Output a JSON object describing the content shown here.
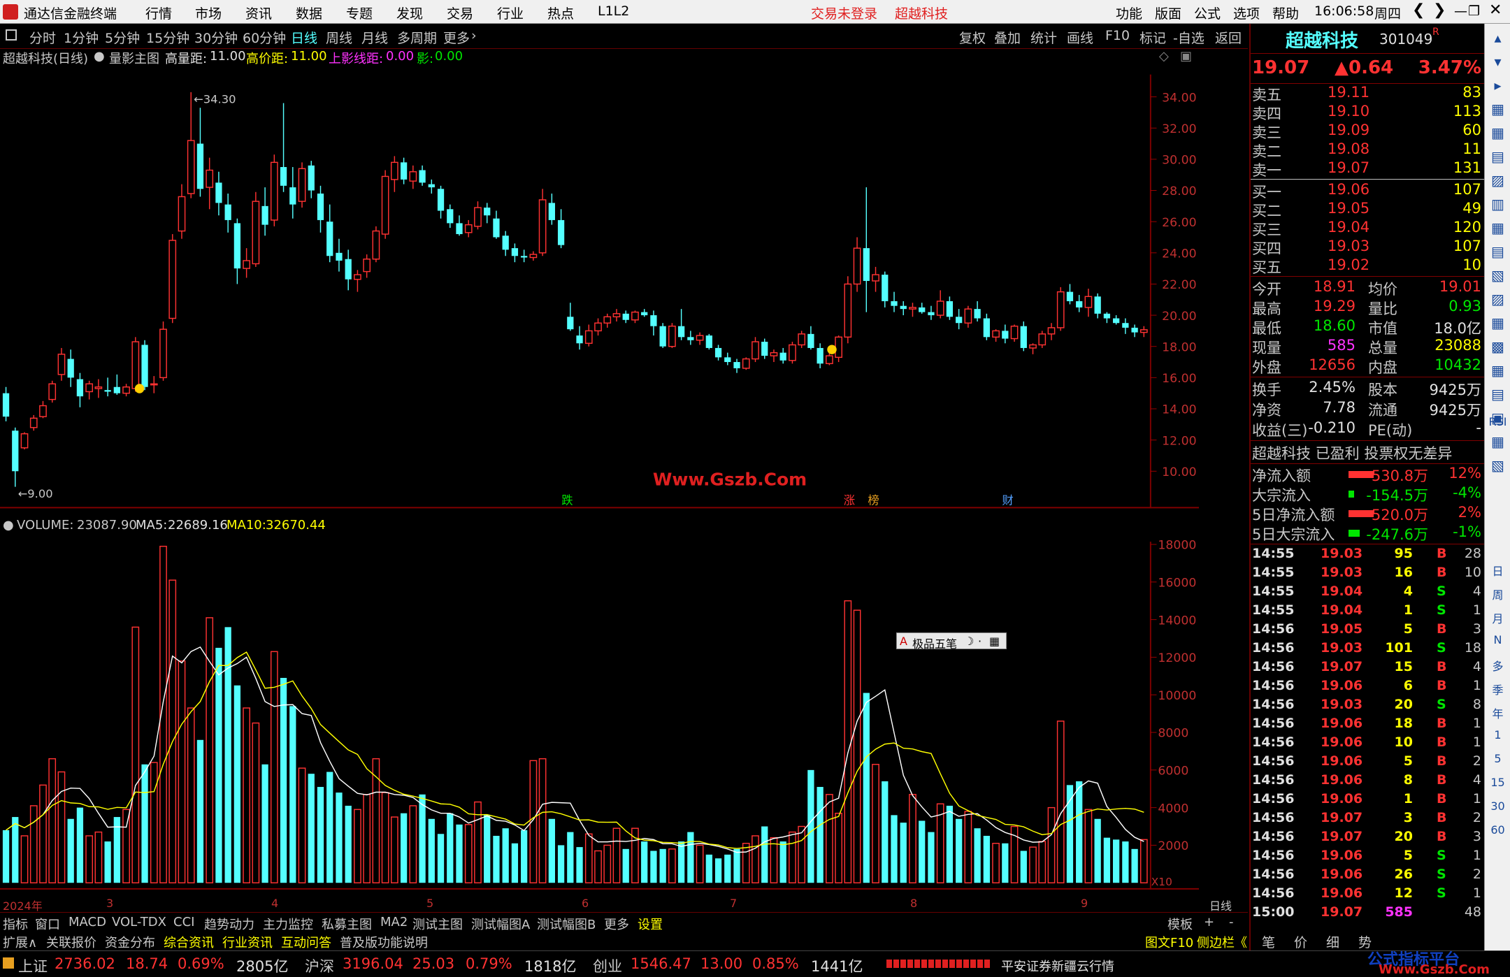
{
  "titlebar": {
    "app": "通达信金融终端",
    "menu": [
      "行情",
      "市场",
      "资讯",
      "数据",
      "专题",
      "发现",
      "交易",
      "行业",
      "热点",
      "L1L2"
    ],
    "login": "交易未登录",
    "stock": "超越科技",
    "right": [
      "功能",
      "版面",
      "公式",
      "选项",
      "帮助"
    ],
    "time": "16:06:58",
    "weekday": "周四"
  },
  "toolbar": {
    "periods": [
      "分时",
      "1分钟",
      "5分钟",
      "15分钟",
      "30分钟",
      "60分钟",
      "日线",
      "周线",
      "月线",
      "多周期",
      "更多"
    ],
    "active": "日线",
    "tools": [
      "复权",
      "叠加",
      "统计",
      "画线",
      "F10",
      "标记",
      "-自选",
      "返回"
    ]
  },
  "chartinfo": {
    "name": "超越科技(日线)",
    "indicator": "量影主图",
    "gao_label": "高量距:",
    "gao_val": "11.00",
    "gaojia_label": "高价距:",
    "gaojia_val": "11.00",
    "shang_label": "上影线距:",
    "shang_val": "0.00",
    "ying_label": "影:",
    "ying_val": "0.00"
  },
  "mainaxis": [
    "34.00",
    "32.00",
    "30.00",
    "28.00",
    "26.00",
    "24.00",
    "22.00",
    "20.00",
    "18.00",
    "16.00",
    "14.00",
    "12.00",
    "10.00"
  ],
  "annotations": {
    "high": "34.30",
    "low": "9.00",
    "watermark": "Www.Gszb.Com",
    "m1": "跌",
    "m2": "涨",
    "m3": "榜",
    "m4": "财"
  },
  "volinfo": {
    "label": "VOLUME:",
    "volume": "23087.90",
    "ma5_label": "MA5:",
    "ma5": "22689.16",
    "ma10_label": "MA10:",
    "ma10": "32670.44"
  },
  "volaxis": [
    "18000",
    "16000",
    "14000",
    "12000",
    "10000",
    "8000",
    "6000",
    "4000",
    "2000"
  ],
  "volunit": "X10",
  "popup": "极品五笔",
  "dates": [
    "2024年",
    "3",
    "4",
    "5",
    "6",
    "7",
    "8",
    "9"
  ],
  "datelabel": "日线",
  "tabs1": [
    "指标",
    "窗口",
    "MACD",
    "VOL-TDX",
    "CCI",
    "趋势动力",
    "主力监控",
    "私募主图",
    "MA2",
    "测试主图",
    "测试幅图A",
    "测试幅图B",
    "更多",
    "设置"
  ],
  "tabs1_right": [
    "模板",
    "+",
    "-"
  ],
  "tabs2": [
    "扩展∧",
    "关联报价",
    "资金分布",
    "综合资讯",
    "行业资讯",
    "互动问答",
    "普及版功能说明"
  ],
  "tabs2_right": [
    "图文F10",
    "侧边栏《"
  ],
  "panel": {
    "name": "超越科技",
    "code": "301049",
    "mark": "R",
    "price": "19.07",
    "change": "▲0.64",
    "pct": "3.47%",
    "asks": [
      [
        "卖五",
        "19.11",
        "83"
      ],
      [
        "卖四",
        "19.10",
        "113"
      ],
      [
        "卖三",
        "19.09",
        "60"
      ],
      [
        "卖二",
        "19.08",
        "11"
      ],
      [
        "卖一",
        "19.07",
        "131"
      ]
    ],
    "bids": [
      [
        "买一",
        "19.06",
        "107"
      ],
      [
        "买二",
        "19.05",
        "49"
      ],
      [
        "买三",
        "19.04",
        "120"
      ],
      [
        "买四",
        "19.03",
        "107"
      ],
      [
        "买五",
        "19.02",
        "10"
      ]
    ],
    "stats": [
      [
        "今开",
        "18.91",
        "均价",
        "19.01"
      ],
      [
        "最高",
        "19.29",
        "量比",
        "0.93"
      ],
      [
        "最低",
        "18.60",
        "市值",
        "18.0亿"
      ],
      [
        "现量",
        "585",
        "总量",
        "23088"
      ],
      [
        "外盘",
        "12656",
        "内盘",
        "10432"
      ]
    ],
    "stats2": [
      [
        "换手",
        "2.45%",
        "股本",
        "9425万"
      ],
      [
        "净资",
        "7.78",
        "流通",
        "9425万"
      ],
      [
        "收益(三)",
        "-0.210",
        "PE(动)",
        "-"
      ]
    ],
    "status": "超越科技 已盈利 投票权无差异",
    "flows": [
      [
        "净流入额",
        "530.8万",
        "12%"
      ],
      [
        "大宗流入",
        "-154.5万",
        "-4%"
      ],
      [
        "5日净流入额",
        "520.0万",
        "2%"
      ],
      [
        "5日大宗流入",
        "-247.6万",
        "-1%"
      ]
    ],
    "ticks": [
      [
        "14:55",
        "19.03",
        "95",
        "B",
        "28"
      ],
      [
        "14:55",
        "19.03",
        "16",
        "B",
        "10"
      ],
      [
        "14:55",
        "19.04",
        "4",
        "S",
        "4"
      ],
      [
        "14:55",
        "19.04",
        "1",
        "S",
        "1"
      ],
      [
        "14:56",
        "19.05",
        "5",
        "B",
        "3"
      ],
      [
        "14:56",
        "19.03",
        "101",
        "S",
        "18"
      ],
      [
        "14:56",
        "19.07",
        "15",
        "B",
        "4"
      ],
      [
        "14:56",
        "19.06",
        "6",
        "B",
        "1"
      ],
      [
        "14:56",
        "19.03",
        "20",
        "S",
        "8"
      ],
      [
        "14:56",
        "19.06",
        "18",
        "B",
        "1"
      ],
      [
        "14:56",
        "19.06",
        "10",
        "B",
        "1"
      ],
      [
        "14:56",
        "19.06",
        "5",
        "B",
        "2"
      ],
      [
        "14:56",
        "19.06",
        "8",
        "B",
        "4"
      ],
      [
        "14:56",
        "19.06",
        "1",
        "B",
        "1"
      ],
      [
        "14:56",
        "19.07",
        "3",
        "B",
        "2"
      ],
      [
        "14:56",
        "19.07",
        "20",
        "B",
        "3"
      ],
      [
        "14:56",
        "19.06",
        "5",
        "S",
        "1"
      ],
      [
        "14:56",
        "19.06",
        "26",
        "S",
        "2"
      ],
      [
        "14:56",
        "19.06",
        "12",
        "S",
        "1"
      ],
      [
        "15:00",
        "19.07",
        "585",
        "",
        "48"
      ]
    ],
    "bottomtabs": [
      "笔",
      "价",
      "细",
      "势"
    ]
  },
  "sidebar": [
    "日",
    "周",
    "月",
    "N",
    "多",
    "季",
    "年",
    "1",
    "5",
    "15",
    "30",
    "60",
    "RSI"
  ],
  "statusbar": {
    "sh_label": "上证",
    "sh": "2736.02",
    "sh_chg": "18.74",
    "sh_pct": "0.69%",
    "sh_amt": "2805亿",
    "hs_label": "沪深",
    "hs": "3196.04",
    "hs_chg": "25.03",
    "hs_pct": "0.79%",
    "hs_amt": "1818亿",
    "cy_label": "创业",
    "cy": "1546.47",
    "cy_chg": "13.00",
    "cy_pct": "0.85%",
    "cy_amt": "1441亿",
    "broker": "平安证券新疆云行情",
    "brand1": "公式指标平台",
    "brand2": "Www.Gszb.Com"
  },
  "chart_data": [
    {
      "type": "candlestick",
      "title": "超越科技(日线)",
      "ylim": [
        9,
        35
      ],
      "ohlc": [
        [
          15.0,
          15.4,
          13.2,
          13.5
        ],
        [
          12.6,
          12.8,
          9.0,
          10.0
        ],
        [
          11.5,
          12.5,
          11.4,
          12.4
        ],
        [
          12.8,
          13.6,
          12.6,
          13.4
        ],
        [
          13.5,
          14.5,
          13.4,
          14.2
        ],
        [
          14.6,
          15.8,
          14.4,
          15.6
        ],
        [
          16.2,
          17.9,
          15.8,
          17.5
        ],
        [
          17.2,
          17.8,
          15.4,
          16.0
        ],
        [
          15.9,
          16.3,
          14.1,
          14.8
        ],
        [
          15.1,
          15.8,
          14.6,
          15.6
        ],
        [
          15.3,
          15.9,
          14.7,
          15.4
        ],
        [
          15.2,
          16.0,
          14.8,
          15.1
        ],
        [
          15.4,
          16.2,
          14.9,
          15.0
        ],
        [
          15.0,
          15.6,
          14.8,
          15.4
        ],
        [
          15.3,
          18.6,
          15.1,
          18.3
        ],
        [
          18.1,
          18.4,
          15.2,
          15.4
        ],
        [
          15.6,
          16.1,
          15.0,
          15.6
        ],
        [
          16.0,
          19.6,
          15.8,
          19.1
        ],
        [
          19.8,
          25.2,
          19.5,
          24.8
        ],
        [
          25.4,
          28.4,
          24.9,
          27.6
        ],
        [
          27.8,
          34.3,
          27.5,
          31.2
        ],
        [
          31.0,
          33.3,
          27.6,
          28.1
        ],
        [
          28.2,
          30.1,
          26.8,
          29.3
        ],
        [
          28.5,
          29.2,
          26.4,
          27.2
        ],
        [
          27.1,
          27.8,
          25.3,
          26.1
        ],
        [
          25.9,
          26.2,
          22.0,
          23.0
        ],
        [
          23.0,
          24.3,
          22.4,
          23.5
        ],
        [
          23.3,
          27.9,
          23.1,
          27.3
        ],
        [
          27.0,
          28.2,
          25.1,
          25.8
        ],
        [
          26.1,
          30.3,
          25.7,
          29.8
        ],
        [
          29.5,
          33.6,
          27.9,
          28.3
        ],
        [
          28.2,
          29.5,
          26.2,
          27.1
        ],
        [
          27.3,
          29.8,
          26.9,
          29.4
        ],
        [
          29.6,
          29.9,
          27.5,
          28.0
        ],
        [
          27.8,
          28.3,
          25.3,
          26.1
        ],
        [
          26.0,
          27.1,
          23.4,
          23.8
        ],
        [
          24.0,
          24.9,
          22.8,
          23.5
        ],
        [
          23.6,
          24.2,
          21.6,
          22.3
        ],
        [
          22.3,
          22.9,
          21.5,
          22.6
        ],
        [
          22.8,
          23.9,
          22.4,
          23.6
        ],
        [
          23.6,
          25.7,
          23.4,
          25.4
        ],
        [
          25.2,
          29.3,
          24.9,
          28.9
        ],
        [
          28.7,
          30.2,
          27.9,
          29.8
        ],
        [
          29.8,
          30.1,
          28.4,
          28.7
        ],
        [
          28.6,
          29.6,
          28.1,
          29.2
        ],
        [
          29.3,
          29.6,
          28.3,
          28.5
        ],
        [
          28.4,
          28.7,
          27.8,
          28.2
        ],
        [
          28.1,
          28.3,
          26.2,
          26.7
        ],
        [
          26.8,
          27.1,
          25.6,
          25.9
        ],
        [
          25.9,
          26.4,
          25.1,
          25.2
        ],
        [
          25.3,
          26.1,
          25.0,
          25.8
        ],
        [
          25.7,
          27.3,
          25.5,
          26.9
        ],
        [
          26.9,
          27.2,
          25.9,
          26.4
        ],
        [
          26.2,
          26.7,
          24.9,
          25.0
        ],
        [
          25.1,
          25.4,
          23.8,
          24.2
        ],
        [
          24.3,
          24.6,
          23.4,
          23.8
        ],
        [
          23.8,
          24.2,
          23.4,
          23.7
        ],
        [
          23.7,
          24.1,
          23.5,
          23.9
        ],
        [
          24.0,
          28.1,
          23.8,
          27.4
        ],
        [
          27.2,
          27.8,
          25.8,
          26.1
        ],
        [
          26.1,
          26.8,
          24.3,
          24.5
        ],
        [
          19.9,
          20.8,
          19.0,
          19.1
        ],
        [
          18.7,
          19.3,
          17.8,
          18.2
        ],
        [
          18.2,
          19.4,
          18.0,
          19.0
        ],
        [
          19.0,
          19.8,
          18.7,
          19.5
        ],
        [
          19.5,
          20.1,
          19.2,
          19.9
        ],
        [
          19.9,
          20.4,
          19.6,
          20.1
        ],
        [
          20.1,
          20.3,
          19.5,
          19.7
        ],
        [
          19.7,
          20.3,
          19.5,
          20.2
        ],
        [
          20.2,
          20.4,
          19.9,
          20.0
        ],
        [
          20.0,
          20.3,
          18.7,
          19.3
        ],
        [
          19.3,
          19.5,
          17.9,
          18.0
        ],
        [
          18.0,
          19.5,
          17.9,
          19.3
        ],
        [
          19.3,
          20.4,
          18.4,
          18.6
        ],
        [
          18.6,
          19.0,
          18.1,
          18.4
        ],
        [
          18.4,
          18.9,
          18.1,
          18.7
        ],
        [
          18.7,
          18.8,
          17.8,
          17.9
        ],
        [
          17.9,
          18.1,
          17.1,
          17.3
        ],
        [
          17.3,
          17.6,
          16.8,
          17.0
        ],
        [
          17.0,
          17.2,
          16.3,
          16.6
        ],
        [
          16.6,
          17.3,
          16.5,
          17.2
        ],
        [
          17.2,
          18.6,
          17.0,
          18.3
        ],
        [
          18.3,
          18.5,
          17.2,
          17.4
        ],
        [
          17.4,
          17.8,
          17.0,
          17.6
        ],
        [
          17.6,
          17.9,
          16.9,
          17.1
        ],
        [
          17.1,
          18.3,
          16.9,
          18.1
        ],
        [
          18.1,
          19.0,
          17.9,
          18.8
        ],
        [
          18.8,
          19.3,
          17.8,
          17.9
        ],
        [
          17.9,
          18.2,
          16.6,
          16.9
        ],
        [
          16.9,
          17.6,
          16.8,
          17.4
        ],
        [
          17.3,
          18.7,
          17.0,
          18.6
        ],
        [
          18.6,
          22.5,
          18.2,
          22.0
        ],
        [
          22.0,
          25.0,
          21.5,
          24.3
        ],
        [
          24.3,
          28.2,
          20.2,
          22.2
        ],
        [
          22.2,
          23.1,
          21.5,
          22.6
        ],
        [
          22.6,
          22.8,
          20.5,
          20.9
        ],
        [
          20.9,
          21.5,
          20.2,
          20.6
        ],
        [
          20.6,
          20.9,
          20.0,
          20.4
        ],
        [
          20.4,
          20.8,
          19.9,
          20.5
        ],
        [
          20.5,
          20.8,
          20.1,
          20.2
        ],
        [
          20.2,
          20.6,
          19.7,
          20.0
        ],
        [
          20.0,
          21.6,
          19.8,
          20.9
        ],
        [
          20.9,
          21.2,
          19.7,
          19.9
        ],
        [
          19.9,
          20.4,
          19.1,
          19.5
        ],
        [
          19.5,
          20.6,
          19.2,
          20.4
        ],
        [
          20.4,
          20.9,
          19.6,
          19.8
        ],
        [
          19.8,
          20.1,
          18.4,
          18.6
        ],
        [
          18.6,
          19.1,
          18.3,
          19.0
        ],
        [
          19.0,
          19.4,
          18.2,
          18.5
        ],
        [
          18.5,
          19.4,
          18.3,
          19.3
        ],
        [
          19.3,
          19.6,
          17.7,
          17.9
        ],
        [
          17.9,
          18.2,
          17.5,
          18.1
        ],
        [
          18.1,
          19.0,
          17.9,
          18.8
        ],
        [
          18.8,
          19.5,
          18.4,
          19.2
        ],
        [
          19.2,
          21.8,
          19.0,
          21.5
        ],
        [
          21.5,
          22.0,
          20.7,
          20.9
        ],
        [
          20.9,
          21.3,
          20.2,
          20.5
        ],
        [
          20.5,
          21.7,
          19.9,
          21.2
        ],
        [
          21.2,
          21.4,
          19.8,
          20.1
        ],
        [
          20.1,
          20.2,
          19.5,
          19.8
        ],
        [
          19.8,
          20.0,
          19.4,
          19.5
        ],
        [
          19.5,
          19.8,
          18.8,
          19.2
        ],
        [
          19.2,
          19.4,
          18.6,
          18.9
        ],
        [
          18.9,
          19.3,
          18.6,
          19.07
        ]
      ]
    },
    {
      "type": "bar",
      "title": "VOLUME",
      "ylim": [
        0,
        18000
      ],
      "values": [
        2800,
        3500,
        2500,
        4100,
        5200,
        6600,
        5900,
        3400,
        4000,
        2500,
        2700,
        2200,
        3500,
        3900,
        13600,
        6300,
        6400,
        17900,
        16100,
        11800,
        9300,
        7600,
        14100,
        12500,
        13600,
        10500,
        9300,
        8500,
        6300,
        12300,
        10900,
        9400,
        6100,
        5800,
        5100,
        5900,
        4800,
        4100,
        3900,
        4700,
        6600,
        4800,
        3500,
        3700,
        4100,
        4700,
        3400,
        2600,
        3700,
        3100,
        3100,
        4300,
        3600,
        2500,
        2900,
        2100,
        2800,
        6500,
        6600,
        3400,
        2000,
        2700,
        1900,
        2600,
        1700,
        2000,
        2900,
        1800,
        2900,
        2200,
        1700,
        1800,
        1800,
        2200,
        2700,
        2000,
        1500,
        1300,
        1500,
        1800,
        2100,
        2500,
        3000,
        2400,
        2200,
        2700,
        3000,
        6000,
        5100,
        4700,
        3700,
        15000,
        14500,
        10100,
        6300,
        5400,
        3600,
        3200,
        4700,
        3300,
        2700,
        4200,
        4100,
        3400,
        3800,
        2900,
        2500,
        2100,
        2100,
        3000,
        1700,
        1900,
        2200,
        4000,
        8600,
        5200,
        5400,
        3900,
        3400,
        2400,
        2300,
        2200,
        1800,
        2300
      ],
      "series": [
        {
          "name": "MA5",
          "color": "#ffffff"
        },
        {
          "name": "MA10",
          "color": "#ffff00"
        }
      ]
    }
  ]
}
